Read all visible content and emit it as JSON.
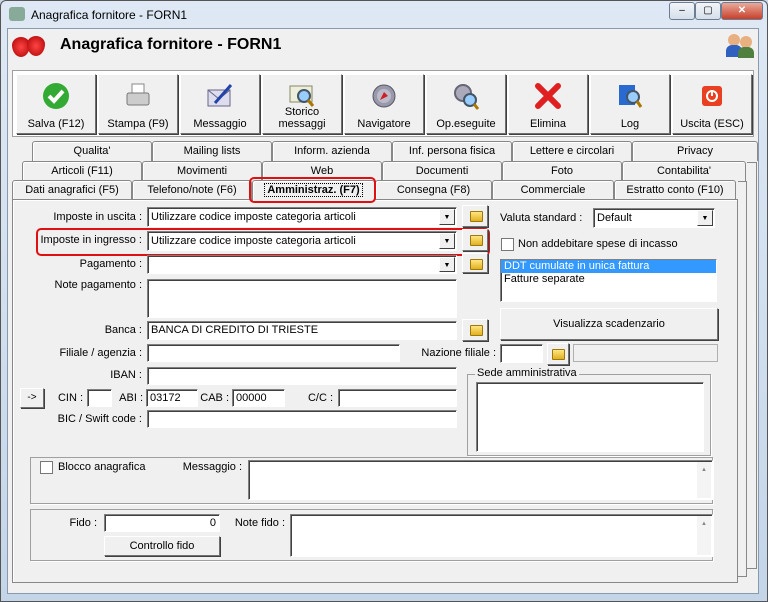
{
  "window": {
    "title": "Anagrafica fornitore - FORN1",
    "controls": [
      "minimize",
      "maximize",
      "close"
    ]
  },
  "header": {
    "title": "Anagrafica fornitore - FORN1"
  },
  "toolbar": [
    {
      "label": "Salva (F12)",
      "icon": "check-icon"
    },
    {
      "label": "Stampa (F9)",
      "icon": "printer-icon"
    },
    {
      "label": "Messaggio",
      "icon": "envelope-pen-icon"
    },
    {
      "label": "Storico messaggi",
      "icon": "envelope-search-icon"
    },
    {
      "label": "Navigatore",
      "icon": "compass-icon"
    },
    {
      "label": "Op.eseguite",
      "icon": "gears-search-icon"
    },
    {
      "label": "Elimina",
      "icon": "delete-x-icon"
    },
    {
      "label": "Log",
      "icon": "book-search-icon"
    },
    {
      "label": "Uscita (ESC)",
      "icon": "power-icon"
    }
  ],
  "tabs": {
    "row1": [
      "Qualita'",
      "Mailing lists",
      "Inform. azienda",
      "Inf. persona fisica",
      "Lettere e circolari",
      "Privacy"
    ],
    "row2": [
      "Articoli (F11)",
      "Movimenti",
      "Web",
      "Documenti",
      "Foto",
      "Contabilita'"
    ],
    "row3": [
      "Dati anagrafici (F5)",
      "Telefono/note (F6)",
      "Amministraz. (F7)",
      "Consegna (F8)",
      "Commerciale",
      "Estratto conto (F10)"
    ],
    "active": "Amministraz. (F7)"
  },
  "form": {
    "imposte_uscita": {
      "label": "Imposte in uscita :",
      "value": "Utilizzare codice imposte categoria articoli"
    },
    "imposte_ingresso": {
      "label": "Imposte in ingresso :",
      "value": "Utilizzare codice imposte categoria articoli"
    },
    "pagamento": {
      "label": "Pagamento :",
      "value": ""
    },
    "note_pagamento": {
      "label": "Note pagamento :",
      "value": ""
    },
    "banca": {
      "label": "Banca :",
      "value": "BANCA DI CREDITO DI TRIESTE"
    },
    "filiale": {
      "label": "Filiale / agenzia :",
      "value": ""
    },
    "nazione_filiale": {
      "label": "Nazione filiale :",
      "value": ""
    },
    "iban": {
      "label": "IBAN :",
      "value": ""
    },
    "arrow_button": "->",
    "cin": {
      "label": "CIN :",
      "value": ""
    },
    "abi": {
      "label": "ABI :",
      "value": "03172"
    },
    "cab": {
      "label": "CAB :",
      "value": "00000"
    },
    "cc": {
      "label": "C/C :",
      "value": ""
    },
    "bic": {
      "label": "BIC / Swift code :",
      "value": ""
    },
    "valuta": {
      "label": "Valuta standard :",
      "value": "Default"
    },
    "non_addebitare": {
      "label": "Non addebitare spese di incasso",
      "checked": false
    },
    "fatturazione": {
      "options": [
        "DDT cumulate in unica fattura",
        "Fatture separate"
      ],
      "selected": 0
    },
    "visualizza_button": "Visualizza scadenzario",
    "sede": {
      "label": "Sede amministrativa",
      "value": ""
    },
    "blocco": {
      "label": "Blocco anagrafica",
      "checked": false
    },
    "messaggio": {
      "label": "Messaggio :",
      "value": ""
    },
    "fido": {
      "label": "Fido :",
      "value": "0"
    },
    "controllo_fido": "Controllo fido",
    "note_fido": {
      "label": "Note fido :",
      "value": ""
    }
  }
}
